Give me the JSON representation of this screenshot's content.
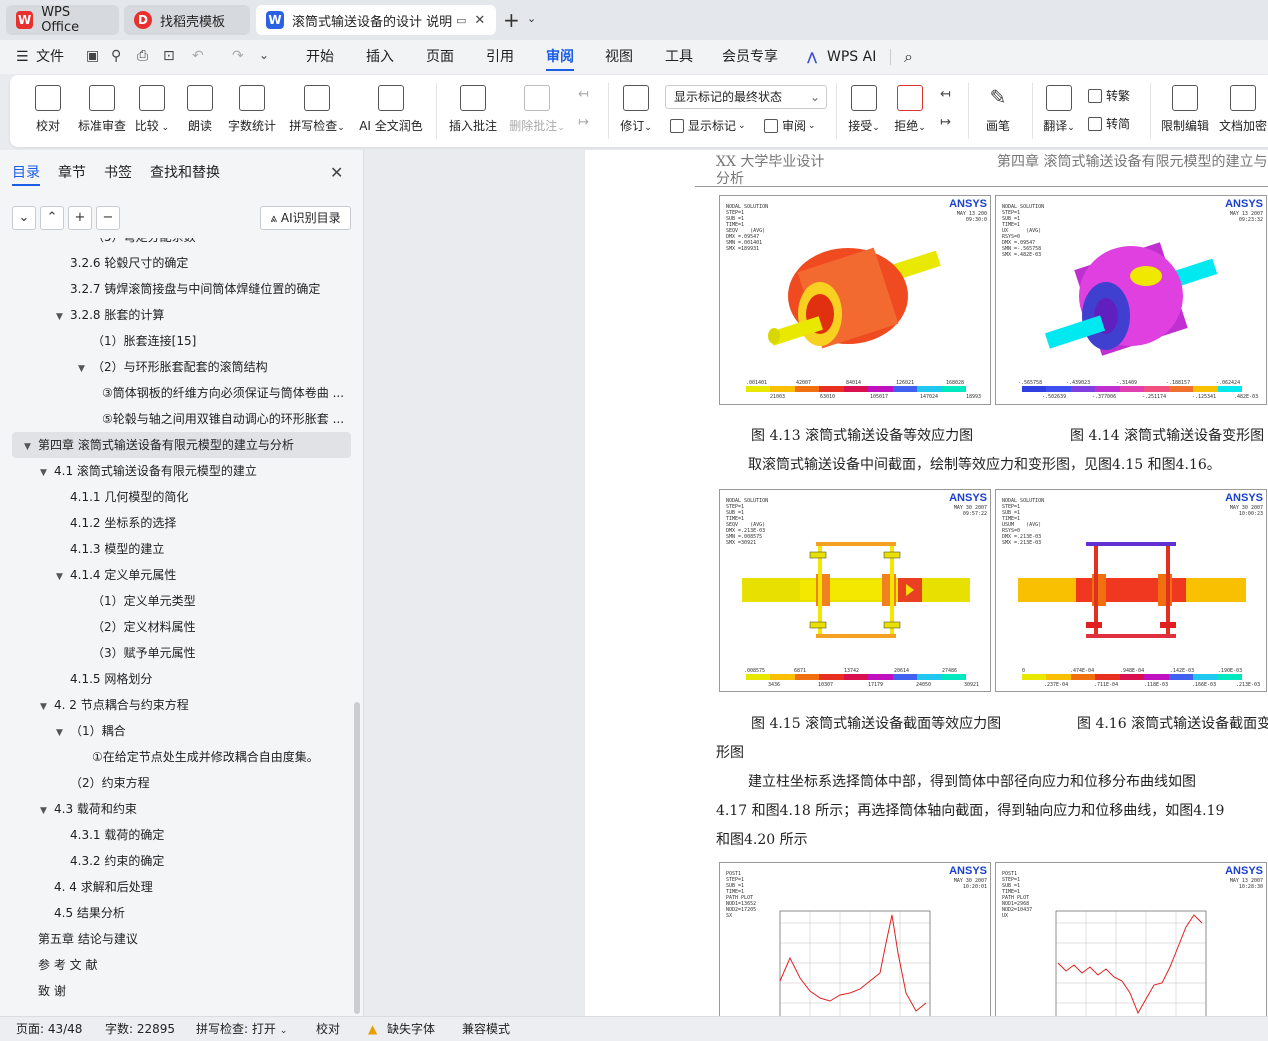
{
  "tabs": [
    {
      "label": "WPS Office",
      "icon": "wps-logo-icon"
    },
    {
      "label": "找稻壳模板",
      "icon": "docer-logo-icon"
    },
    {
      "label": "滚筒式输送设备的设计 说明书",
      "icon": "writer-logo-icon"
    }
  ],
  "menu": {
    "file": "文件",
    "items": [
      "开始",
      "插入",
      "页面",
      "引用",
      "审阅",
      "视图",
      "工具",
      "会员专享"
    ],
    "active": "审阅",
    "ai": "WPS AI"
  },
  "ribbon": {
    "proofread": "校对",
    "std_review": "标准审查",
    "compare": "比较",
    "read_aloud": "朗读",
    "word_count": "字数统计",
    "spell_check": "拼写检查",
    "ai_polish": "AI 全文润色",
    "insert_comment": "插入批注",
    "delete_comment": "删除批注",
    "track": "修订",
    "markup_mode": "显示标记的最终状态",
    "show_markup": "显示标记",
    "review": "审阅",
    "accept": "接受",
    "reject": "拒绝",
    "pen": "画笔",
    "translate": "翻译",
    "to_traditional": "转繁",
    "to_simplified": "转简",
    "restrict": "限制编辑",
    "encrypt": "文档加密"
  },
  "nav": {
    "tabs": [
      "目录",
      "章节",
      "书签",
      "查找和替换"
    ],
    "ai_toc": "AI识别目录",
    "items": [
      {
        "text": "（5）弯矩分配系数",
        "level": 3
      },
      {
        "text": "3.2.6  轮毂尺寸的确定",
        "level": 2
      },
      {
        "text": "3.2.7  铸焊滚筒接盘与中间筒体焊缝位置的确定",
        "level": 2
      },
      {
        "text": "3.2.8  胀套的计算",
        "level": 2,
        "expanded": true
      },
      {
        "text": "（1）胀套连接[15]",
        "level": 3
      },
      {
        "text": "（2）与环形胀套配套的滚筒结构",
        "level": 3,
        "expanded": true
      },
      {
        "text": "③筒体钢板的纤维方向必须保证与筒体卷曲 ...",
        "level": 4
      },
      {
        "text": "⑤轮毂与轴之间用双锥自动调心的环形胀套 ...",
        "level": 4
      },
      {
        "text": "第四章  滚筒式输送设备有限元模型的建立与分析",
        "level": 0,
        "expanded": true,
        "selected": true
      },
      {
        "text": "4.1  滚筒式输送设备有限元模型的建立",
        "level": 1,
        "expanded": true
      },
      {
        "text": "4.1.1  几何模型的简化",
        "level": 2
      },
      {
        "text": "4.1.2  坐标系的选择",
        "level": 2
      },
      {
        "text": "4.1.3  模型的建立",
        "level": 2
      },
      {
        "text": "4.1.4  定义单元属性",
        "level": 2,
        "expanded": true
      },
      {
        "text": "（1）定义单元类型",
        "level": 3
      },
      {
        "text": "（2）定义材料属性",
        "level": 3
      },
      {
        "text": "（3）赋予单元属性",
        "level": 3
      },
      {
        "text": "4.1.5  网格划分",
        "level": 2
      },
      {
        "text": "4. 2  节点耦合与约束方程",
        "level": 1,
        "expanded": true
      },
      {
        "text": "（1）耦合",
        "level": 2,
        "expanded": true
      },
      {
        "text": "①在给定节点处生成并修改耦合自由度集。",
        "level": 3
      },
      {
        "text": "（2）约束方程",
        "level": 2
      },
      {
        "text": "4.3  载荷和约束",
        "level": 1,
        "expanded": true
      },
      {
        "text": "4.3.1  载荷的确定",
        "level": 2
      },
      {
        "text": "4.3.2  约束的确定",
        "level": 2
      },
      {
        "text": "4. 4  求解和后处理",
        "level": 1
      },
      {
        "text": "4.5  结果分析",
        "level": 1
      },
      {
        "text": "第五章  结论与建议",
        "level": 0
      },
      {
        "text": "参 考 文 献",
        "level": 0
      },
      {
        "text": "致    谢",
        "level": 0
      }
    ]
  },
  "doc": {
    "header_left_1": "XX 大学毕业设计",
    "header_left_2": "分析",
    "header_right": "第四章  滚筒式输送设备有限元模型的建立与",
    "cap_413": "图 4.13  滚筒式输送设备等效应力图",
    "cap_414": "图 4.14  滚筒式输送设备变形图",
    "para1": "取滚筒式输送设备中间截面，绘制等效应力和变形图，见图4.15 和图4.16。",
    "cap_415": "图 4.15  滚筒式输送设备截面等效应力图",
    "cap_416": "图 4.16  滚筒式输送设备截面变",
    "cap_416_cont": "形图",
    "para2_l1": "建立柱坐标系选择筒体中部，得到筒体中部径向应力和位移分布曲线如图",
    "para2_l2": "4.17  和图4.18  所示；再选择筒体轴向截面，得到轴向应力和位移曲线，如图4.19",
    "para2_l3": "和图4.20  所示",
    "ansys_a": "AN",
    "ansys_b": "SYS",
    "fig413": {
      "meta": "NODAL SOLUTION\nSTEP=1\nSUB =1\nTIME=1\nSEQV    (AVG)\nDMX =.09547\nSMN =.001401\nSMX =189931",
      "date": "MAY 13 200\n09:30:0",
      "legend_top": [
        ".001401",
        "42007",
        "84014",
        "126021",
        "168028"
      ],
      "legend_bot": [
        "21003",
        "63010",
        "105017",
        "147024",
        "18993"
      ]
    },
    "fig414": {
      "meta": "NODAL SOLUTION\nSTEP=1\nSUB =1\nTIME=1\nUX      (AVG)\nRSYS=0\nDMX =.09547\nSMN =-.565758\nSMX =.482E-03",
      "date": "MAY 13 2007\n09:23:32",
      "legend_top": [
        "-.565758",
        "-.439023",
        "-.31409",
        "-.188157",
        "-.062424"
      ],
      "legend_bot": [
        "-.502639",
        "-.377006",
        "-.251174",
        "-.125341",
        ".482E-03"
      ]
    },
    "fig415": {
      "meta": "NODAL SOLUTION\nSTEP=1\nSUB =1\nTIME=1\nSEQV    (AVG)\nDMX =.213E-03\nSMN =.008575\nSMX =30921",
      "date": "MAY 30 2007\n09:57:22",
      "legend_top": [
        ".008575",
        "6871",
        "13742",
        "20614",
        "27486"
      ],
      "legend_bot": [
        "3436",
        "10307",
        "17179",
        "24050",
        "30921"
      ]
    },
    "fig416": {
      "meta": "NODAL SOLUTION\nSTEP=1\nSUB =1\nTIME=1\nUSUM    (AVG)\nRSYS=0\nDMX =.213E-03\nSMX =.213E-03",
      "date": "MAY 30 2007\n10:00:23",
      "legend_top": [
        "0",
        ".474E-04",
        ".948E-04",
        ".142E-03",
        ".190E-03"
      ],
      "legend_bot": [
        ".237E-04",
        ".711E-04",
        ".118E-03",
        ".166E-03",
        ".213E-03"
      ]
    },
    "fig417": {
      "meta": "POST1\nSTEP=1\nSUB =1\nTIME=1\nPATH PLOT\nNOD1=13652\nNOD2=17205\nSX",
      "date": "MAY 30 2007\n10:20:01"
    },
    "fig418": {
      "meta": "POST1\nSTEP=1\nSUB =1\nTIME=1\nPATH PLOT\nNOD1=2968\nNOD2=10437\nUX",
      "date": "MAY 13 2007\n10:28:30"
    }
  },
  "status": {
    "page": "页面: 43/48",
    "words": "字数: 22895",
    "spell": "拼写检查: 打开",
    "proof": "校对",
    "missing_font": "缺失字体",
    "compat": "兼容模式"
  },
  "colors": {
    "accent": "#1a5ee8",
    "wps_red": "#e8312f",
    "writer_blue": "#2b62e4"
  }
}
